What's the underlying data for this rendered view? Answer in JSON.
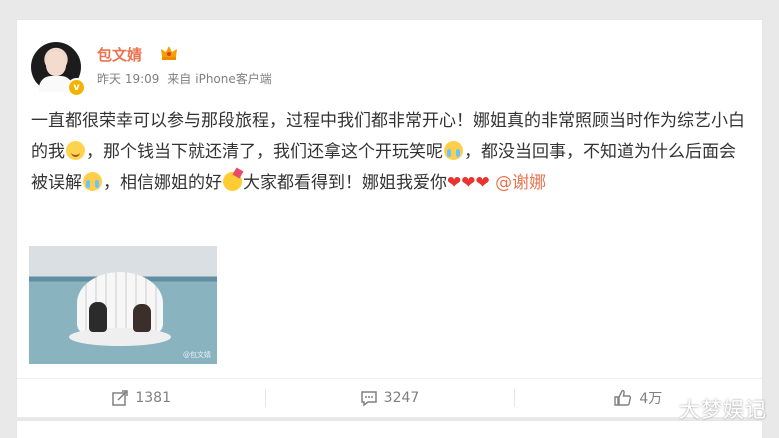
{
  "post": {
    "author": "包文婧",
    "time": "昨天 19:09",
    "source_prefix": "来自",
    "source": "iPhone客户端",
    "text_parts": {
      "p1": "一直都很荣幸可以参与那段旅程，过程中我们都非常开心！娜姐真的非常照顾当时作为综艺小白的我",
      "p2": "，那个钱当下就还清了，我们还拿这个开玩笑呢",
      "p3": "，都没当回事，不知道为什么后面会被误解",
      "p4": "，相信娜姐的好",
      "p5": "大家都看得到！娜姐我爱你",
      "mention": "@谢娜"
    },
    "image_watermark": "@包文婧"
  },
  "actions": {
    "share_count": "1381",
    "comment_count": "3247",
    "like_count": "4万"
  },
  "watermark": "大梦娱记",
  "icons": [
    "verified-icon",
    "crown-icon",
    "share-icon",
    "comment-icon",
    "like-icon"
  ],
  "colors": {
    "username": "#eb7350",
    "mention": "#eb7350",
    "verified": "#f4b300",
    "heart": "#e8332e"
  }
}
